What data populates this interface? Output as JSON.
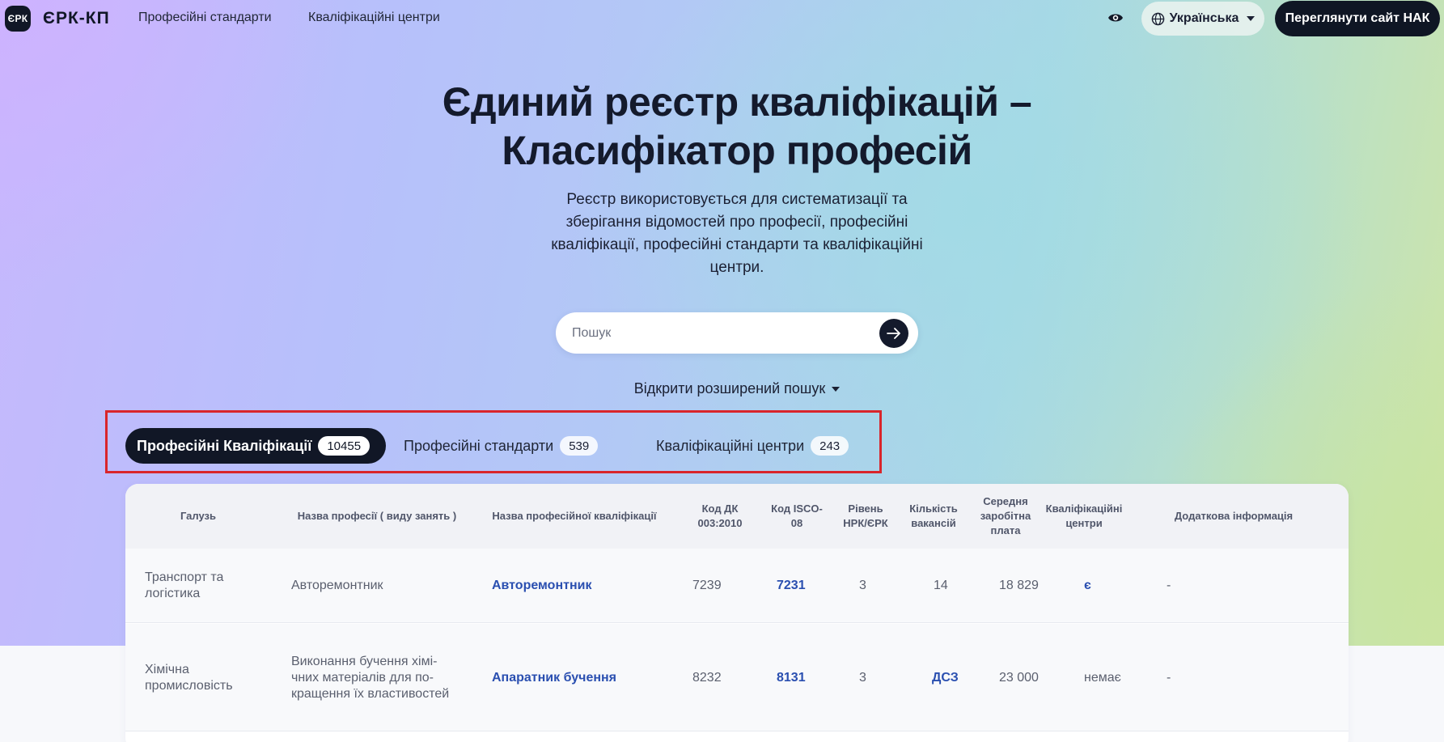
{
  "header": {
    "logo_badge": "ЄРК",
    "logo_text": "ЄРК-КП",
    "nav": [
      "Професійні стандарти",
      "Кваліфікаційні центри"
    ],
    "language": "Українська",
    "nak_button": "Переглянути сайт НАК"
  },
  "hero": {
    "title_line1": "Єдиний реєстр кваліфікацій –",
    "title_line2": "Класифікатор професій",
    "desc_line1": "Реєстр використовується для систематизації та",
    "desc_line2": "зберігання відомостей про професії, професійні",
    "desc_line3": "кваліфікації, професійні стандарти та кваліфікаційні",
    "desc_line4": "центри.",
    "search_placeholder": "Пошук",
    "advanced_search": "Відкрити розширений пошук"
  },
  "tabs": [
    {
      "label": "Професійні Кваліфікації",
      "count": "10455"
    },
    {
      "label": "Професійні стандарти",
      "count": "539"
    },
    {
      "label": "Кваліфікаційні центри",
      "count": "243"
    }
  ],
  "table": {
    "headers": {
      "industry": "Галузь",
      "profession": "Назва професії ( виду занять )",
      "qualification": "Назва професійної кваліфікації",
      "dk": "Код ДК 003:2010",
      "isco": "Код ISCO-08",
      "level": "Рівень НРК/ЄРК",
      "vacancies": "Кількість вакансій",
      "salary": "Середня заробітна плата",
      "centers": "Кваліфікаційні центри",
      "extra": "Додаткова інформація"
    },
    "rows": [
      {
        "industry": "Транспорт та логістика",
        "profession": "Авторемонтник",
        "qualification": "Авторемонтник",
        "dk": "7239",
        "isco": "7231",
        "level": "3",
        "vacancies": "14",
        "salary": "18 829",
        "centers": "є",
        "extra": "-"
      },
      {
        "industry": "Хімічна промисловість",
        "profession": "Виконання бучення хімі-чних матеріалів для по-кращення їх властивостей",
        "qualification": "Апаратник бучення",
        "dk": "8232",
        "isco": "8131",
        "level": "3",
        "vacancies": "ДСЗ",
        "salary": "23 000",
        "centers": "немає",
        "extra": "-"
      }
    ]
  }
}
